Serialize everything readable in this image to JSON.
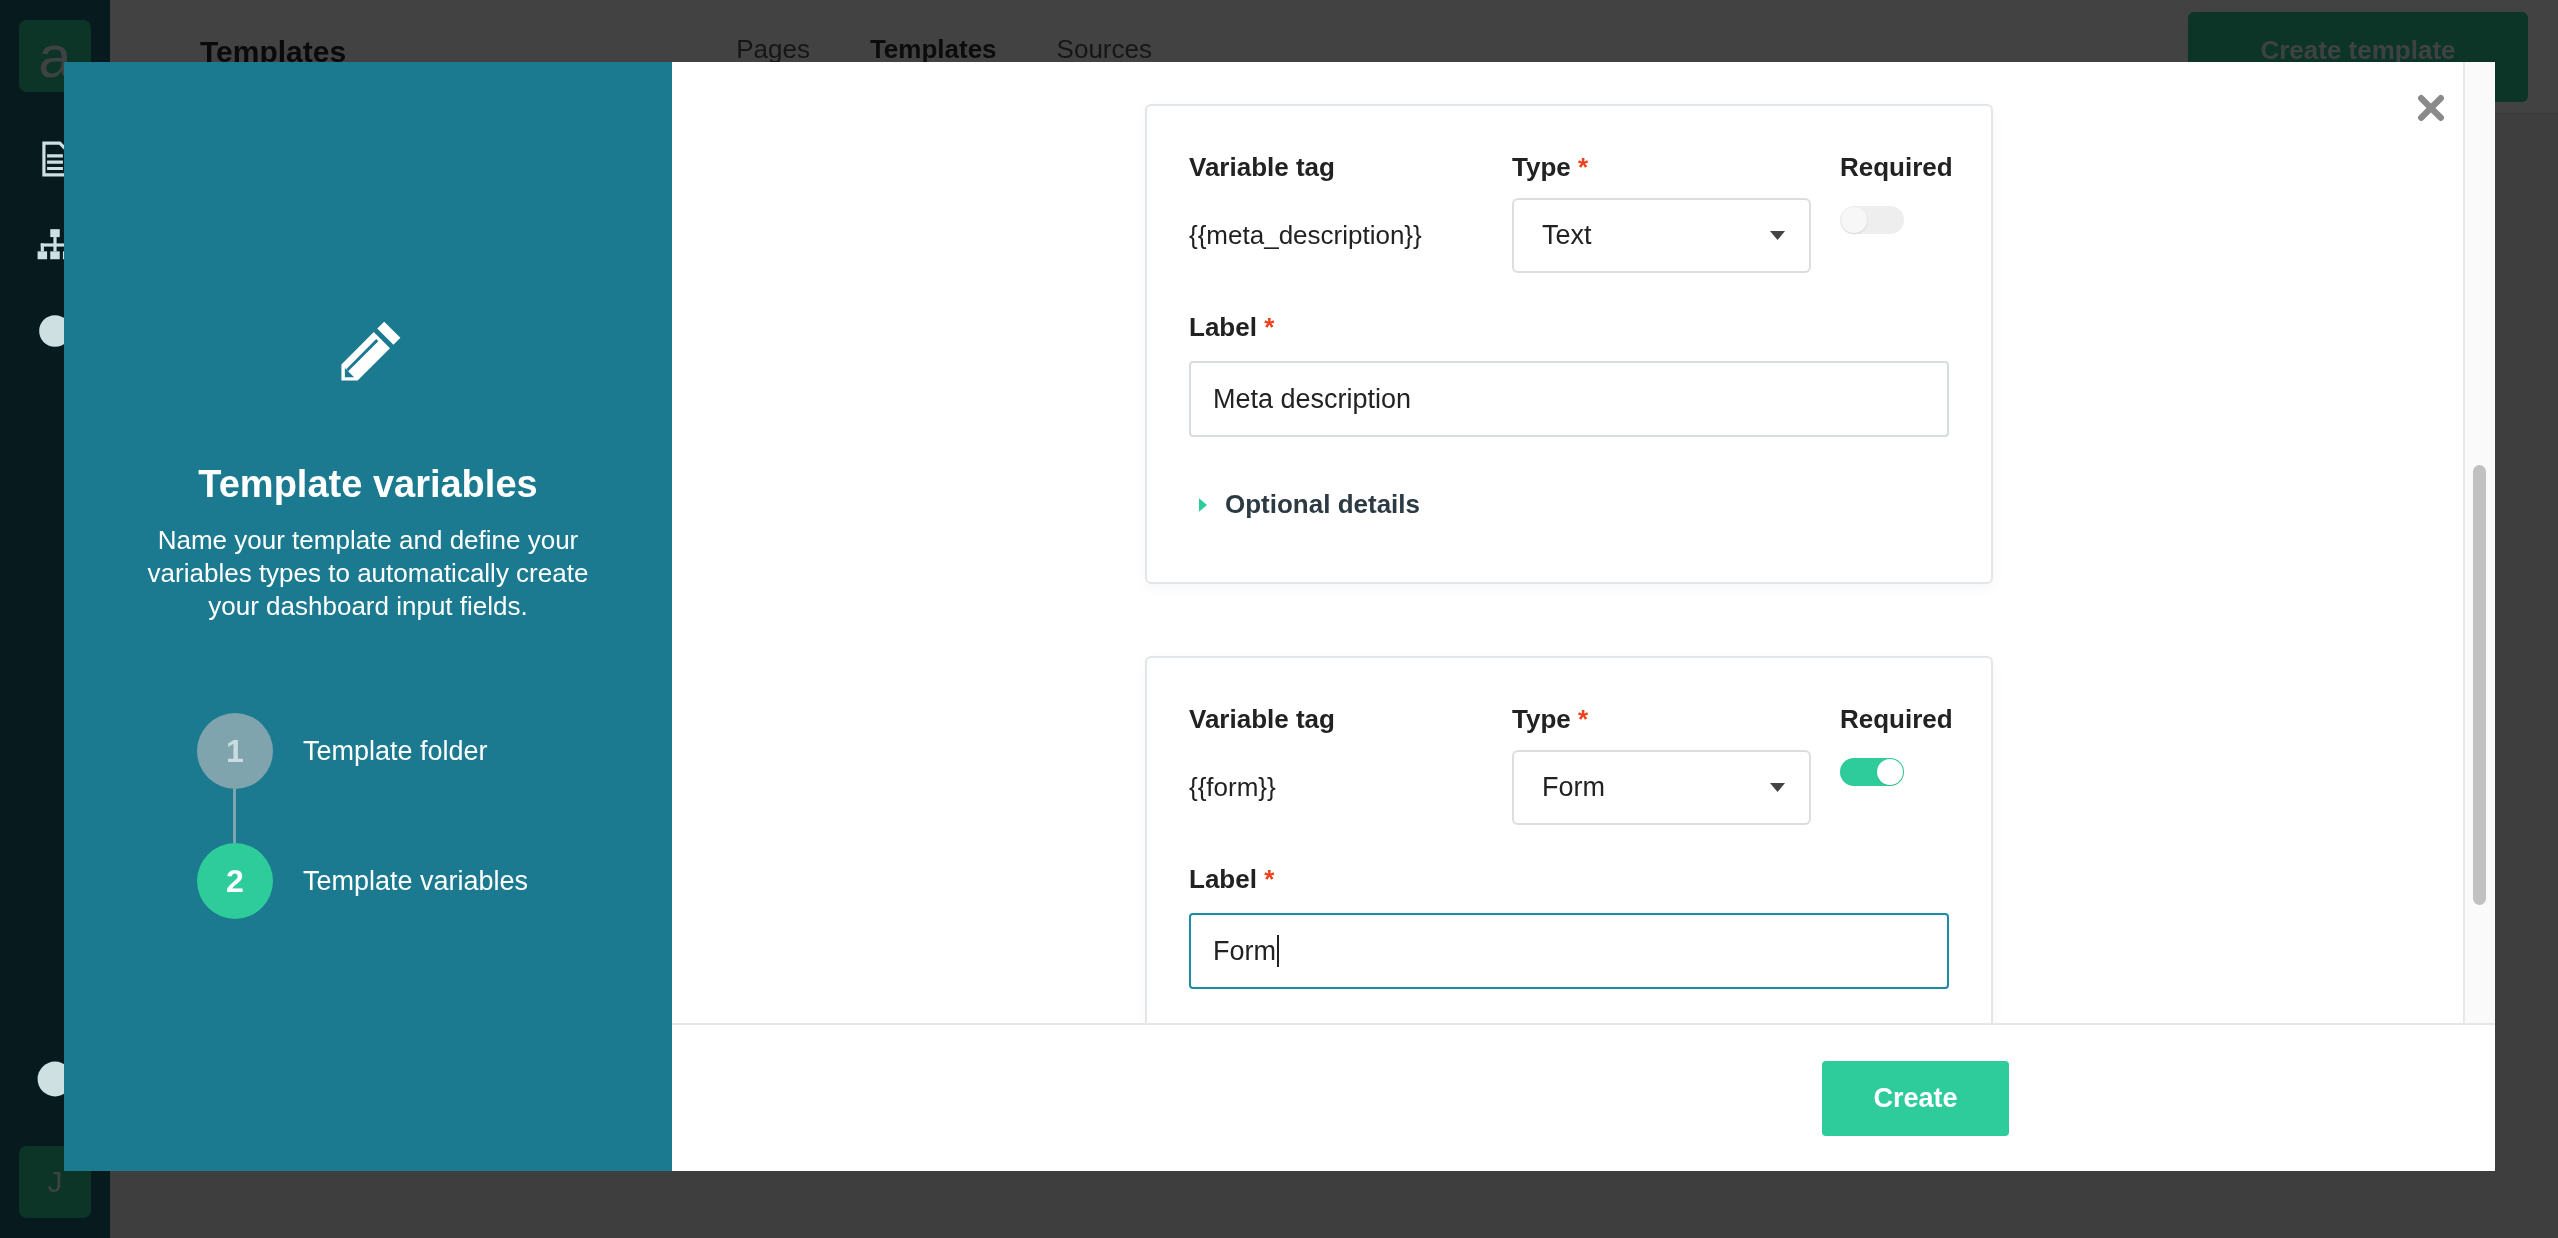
{
  "app": {
    "logo": "a",
    "page_title": "Templates",
    "nav": [
      {
        "label": "Pages",
        "selected": false
      },
      {
        "label": "Templates",
        "selected": true
      },
      {
        "label": "Sources",
        "selected": false
      }
    ],
    "create_button": "Create template",
    "avatar": "J"
  },
  "modal": {
    "title": "Template variables",
    "description": "Name your template and define your variables types to automatically create your dashboard input fields.",
    "steps": [
      {
        "number": "1",
        "label": "Template folder",
        "selected": false
      },
      {
        "number": "2",
        "label": "Template variables",
        "selected": true
      }
    ],
    "variables": [
      {
        "tag_heading": "Variable tag",
        "tag": "{{meta_description}}",
        "type_heading": "Type",
        "type_mark": "*",
        "type_value": "Text",
        "required_heading": "Required",
        "required": false,
        "label_heading": "Label",
        "label_mark": "*",
        "label_value": "Meta description",
        "focused": false,
        "optional_details": "Optional details"
      },
      {
        "tag_heading": "Variable tag",
        "tag": "{{form}}",
        "type_heading": "Type",
        "type_mark": "*",
        "type_value": "Form",
        "required_heading": "Required",
        "required": true,
        "label_heading": "Label",
        "label_mark": "*",
        "label_value": "Form",
        "focused": true
      }
    ],
    "create_button": "Create"
  }
}
